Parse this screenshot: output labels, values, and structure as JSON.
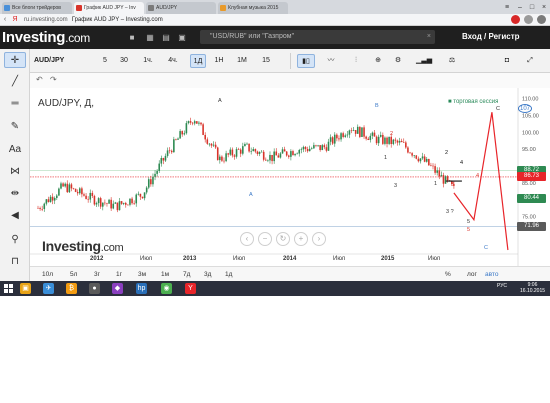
{
  "browser": {
    "tabs": [
      {
        "label": "Все блоги трейдеров",
        "color": "#4a90d9"
      },
      {
        "label": "График AUD JPY – Inv",
        "color": "#d8342b"
      },
      {
        "label": "AUD/JPY",
        "color": "#7a7a7a"
      },
      {
        "label": "Клубная музыка 2015",
        "color": "#e89a2b"
      }
    ],
    "url": "ru.investing.com",
    "page_title": "График AUD JPY – Investing.com",
    "back_icon": "back-arrow-icon",
    "yandex_icon": "yandex-icon"
  },
  "site": {
    "logo": "Investing",
    "logo_suffix": ".com",
    "search_placeholder": "\"USD/RUB\" или \"Газпром\"",
    "search_close": "×",
    "login_label": "Вход / Регистр"
  },
  "chart_toolbar": {
    "symbol": "AUD/JPY",
    "intervals": [
      "5",
      "30",
      "1ч.",
      "4ч.",
      "1Д",
      "1Н",
      "1М",
      "15"
    ],
    "selected_interval": "1Д"
  },
  "chart": {
    "symbol_label": "AUD/JPY, Д,",
    "legend": "■ торговая сессия",
    "watermark": "Investing",
    "watermark_suffix": ".com",
    "current_price": "86.73",
    "price_tags": [
      {
        "label": "88.72",
        "bg": "#2e8a52",
        "price": 88.72
      },
      {
        "label": "86.73",
        "bg": "#e8252a",
        "price": 86.73
      },
      {
        "label": "80.44",
        "bg": "#2e8a52",
        "price": 80.44
      },
      {
        "label": "71.96",
        "bg": "#5a5a5a",
        "price": 71.96
      },
      {
        "label": "107",
        "bg": "#ffffff",
        "price": 107.0
      }
    ],
    "price_ticks": [
      "110.00",
      "105.00",
      "100.00",
      "95.00",
      "85.00",
      "75.00"
    ],
    "x_labels": [
      {
        "text": "2012",
        "year": true
      },
      {
        "text": "Июл",
        "year": false
      },
      {
        "text": "2013",
        "year": true
      },
      {
        "text": "Июл",
        "year": false
      },
      {
        "text": "2014",
        "year": true
      },
      {
        "text": "Июл",
        "year": false
      },
      {
        "text": "2015",
        "year": true
      },
      {
        "text": "Июл",
        "year": false
      }
    ],
    "wave_labels": [
      "A",
      "B",
      "C",
      "A",
      "B",
      "C",
      "1",
      "2",
      "3",
      "4",
      "5",
      "1",
      "2",
      "3",
      "4",
      "5",
      "3 ?"
    ],
    "zoom_controls": [
      "‹",
      "−",
      "↻",
      "+",
      "›"
    ],
    "periods": [
      "10л",
      "5л",
      "3г",
      "1г",
      "3м",
      "1м",
      "7д",
      "3д",
      "1д"
    ],
    "bottom_right": [
      "%",
      "лог",
      "авто"
    ]
  },
  "chart_data": {
    "type": "candlestick",
    "symbol": "AUD/JPY",
    "timeframe": "1D",
    "x": [
      "2011-10",
      "2012-01",
      "2012-04",
      "2012-07",
      "2012-10",
      "2013-01",
      "2013-04",
      "2013-07",
      "2013-10",
      "2014-01",
      "2014-04",
      "2014-07",
      "2014-10",
      "2015-01",
      "2015-04",
      "2015-07",
      "2015-09"
    ],
    "close": [
      77.5,
      84.0,
      80.5,
      78.0,
      81.5,
      94.0,
      104.5,
      92.0,
      95.5,
      92.5,
      95.0,
      95.5,
      101.5,
      98.0,
      96.5,
      90.5,
      83.0
    ],
    "projection": {
      "x": [
        "2015-09",
        "2015-10",
        "2015-11",
        "2015-12"
      ],
      "y": [
        82.0,
        74.0,
        106.0,
        65.0
      ]
    },
    "ylim": [
      65,
      112
    ],
    "grid": false
  },
  "taskbar": {
    "icons": [
      {
        "name": "explorer-icon",
        "color": "#e8a317",
        "glyph": "▣"
      },
      {
        "name": "telegram-icon",
        "color": "#3a8ed8",
        "glyph": "✈"
      },
      {
        "name": "bitcoin-icon",
        "color": "#f39c12",
        "glyph": "₿"
      },
      {
        "name": "app-icon",
        "color": "#5a5a5a",
        "glyph": "●"
      },
      {
        "name": "media-icon",
        "color": "#8a3fbf",
        "glyph": "◆"
      },
      {
        "name": "hp-icon",
        "color": "#2a6fb8",
        "glyph": "hp"
      },
      {
        "name": "chrome-icon",
        "color": "#4caf50",
        "glyph": "◉"
      },
      {
        "name": "yandex-browser-icon",
        "color": "#e8252a",
        "glyph": "Y"
      }
    ],
    "tray": "РУС",
    "time": "9:06",
    "date": "16.10.2015"
  }
}
